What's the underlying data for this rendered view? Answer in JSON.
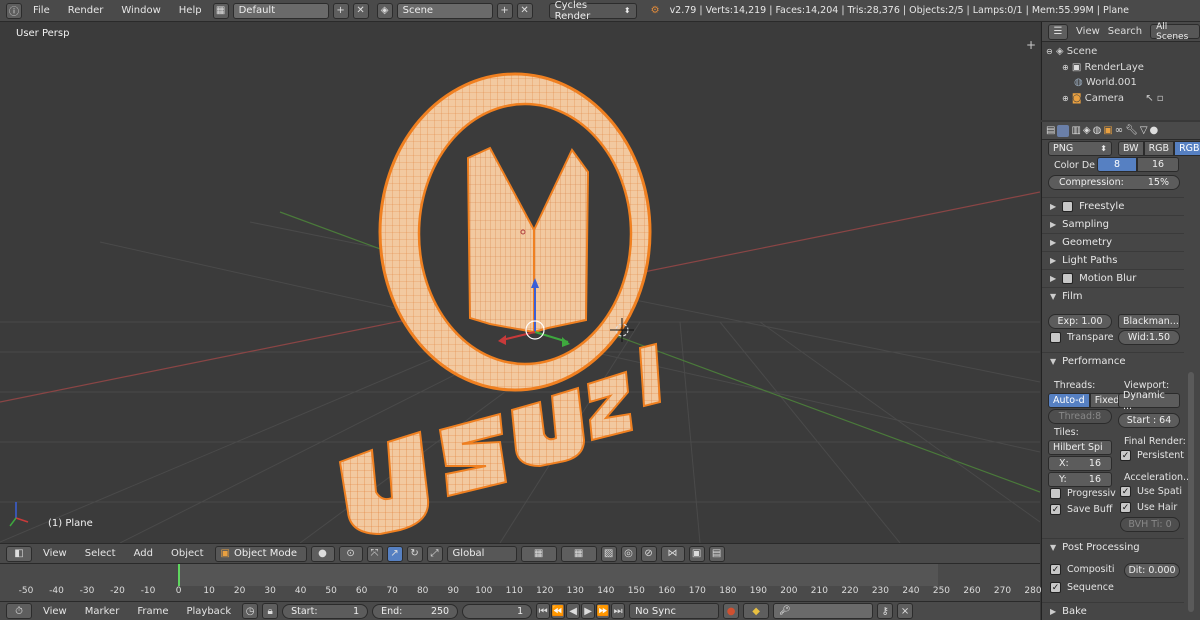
{
  "topbar": {
    "menus": [
      "File",
      "Render",
      "Window",
      "Help"
    ],
    "screen_layout": "Default",
    "scene": "Scene",
    "render_engine": "Cycles Render",
    "stats": "v2.79 | Verts:14,219 | Faces:14,204 | Tris:28,376 | Objects:2/5 | Lamps:0/1 | Mem:55.99M | Plane"
  },
  "viewport": {
    "view_label": "User Persp",
    "object_label": "(1) Plane",
    "logo_text": "USUZI"
  },
  "outliner": {
    "menu": [
      "View",
      "Search"
    ],
    "filter": "All Scenes",
    "items": [
      "Scene",
      "RenderLaye",
      "World.001",
      "Camera"
    ]
  },
  "properties": {
    "format": "PNG",
    "color_modes": [
      "BW",
      "RGB",
      "RGB"
    ],
    "color_depth_label": "Color De",
    "color_depths": [
      "8",
      "16"
    ],
    "compression": "Compression:",
    "compression_value": "15%",
    "panels": [
      "Freestyle",
      "Sampling",
      "Geometry",
      "Light Paths",
      "Motion Blur",
      "Film"
    ],
    "film": {
      "exposure": "Exp: 1.00",
      "filter": "Blackman...",
      "transparent": "Transpare",
      "width": "Wid:1.50"
    },
    "performance": {
      "title": "Performance",
      "threads_label": "Threads:",
      "threads_auto": "Auto-d",
      "threads_fixed": "Fixed",
      "threads_count": "Thread:8",
      "viewport_label": "Viewport:",
      "viewport_mode": "Dynamic ...",
      "start": "Start : 64",
      "tiles_label": "Tiles:",
      "tile_order": "Hilbert Spi",
      "tile_x": "X:",
      "tile_x_val": "16",
      "tile_y": "Y:",
      "tile_y_val": "16",
      "final_render": "Final Render:",
      "persistent": "Persistent",
      "acceleration": "Acceleration...",
      "use_spatial": "Use Spati",
      "use_hair": "Use Hair",
      "bvh": "BVH Ti: 0",
      "progressive": "Progressiv",
      "save_buffers": "Save Buff"
    },
    "post_processing": {
      "title": "Post Processing",
      "compositing": "Compositi",
      "dither": "Dit: 0.000",
      "sequence": "Sequence"
    },
    "bake": "Bake"
  },
  "view3d_header": {
    "menus": [
      "View",
      "Select",
      "Add",
      "Object"
    ],
    "mode": "Object Mode",
    "orientation": "Global"
  },
  "timeline": {
    "ticks": [
      "-50",
      "-40",
      "-30",
      "-20",
      "-10",
      "0",
      "10",
      "20",
      "30",
      "40",
      "50",
      "60",
      "70",
      "80",
      "90",
      "100",
      "110",
      "120",
      "130",
      "140",
      "150",
      "160",
      "170",
      "180",
      "190",
      "200",
      "210",
      "220",
      "230",
      "240",
      "250",
      "260",
      "270",
      "280"
    ],
    "menus": [
      "View",
      "Marker",
      "Frame",
      "Playback"
    ],
    "start": "Start:",
    "start_val": "1",
    "end": "End:",
    "end_val": "250",
    "current": "1",
    "sync": "No Sync"
  },
  "colors": {
    "selection_orange": "#f08020",
    "mesh_fill": "#f2c9a0",
    "blue_accent": "#5680c2"
  }
}
